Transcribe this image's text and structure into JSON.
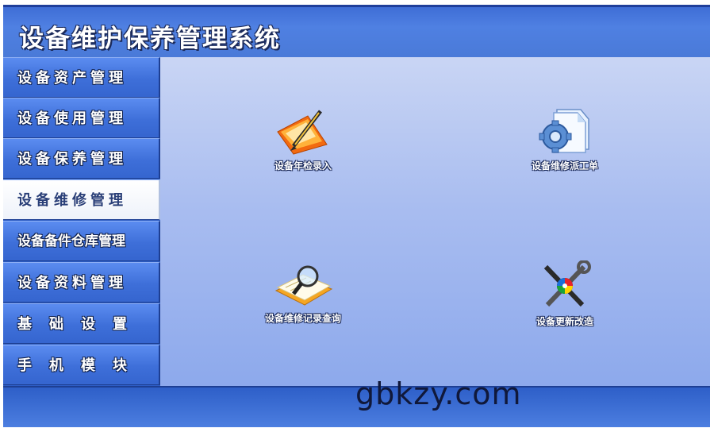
{
  "app": {
    "title": "设备维护保养管理系统"
  },
  "sidebar": {
    "items": [
      {
        "label": "设备资产管理"
      },
      {
        "label": "设备使用管理"
      },
      {
        "label": "设备保养管理"
      },
      {
        "label": "设备维修管理"
      },
      {
        "label": "设备备件仓库管理"
      },
      {
        "label": "设备资料管理"
      },
      {
        "label": "基础设置"
      },
      {
        "label": "手机模块"
      }
    ],
    "active_index": 3
  },
  "main": {
    "tiles": [
      {
        "label": "设备年检录入",
        "icon": "pencil-paper-icon"
      },
      {
        "label": "设备维修派工单",
        "icon": "gear-document-icon"
      },
      {
        "label": "设备维修记录查询",
        "icon": "magnifier-document-icon"
      },
      {
        "label": "设备更新改造",
        "icon": "tools-icon"
      }
    ]
  },
  "watermark": {
    "text": "gbkzy.com"
  },
  "colors": {
    "header": "#4a7ad8",
    "sidebar": "#3e6fd9",
    "active_item": "#ffffff",
    "main_bg": "#a9bdf0"
  }
}
